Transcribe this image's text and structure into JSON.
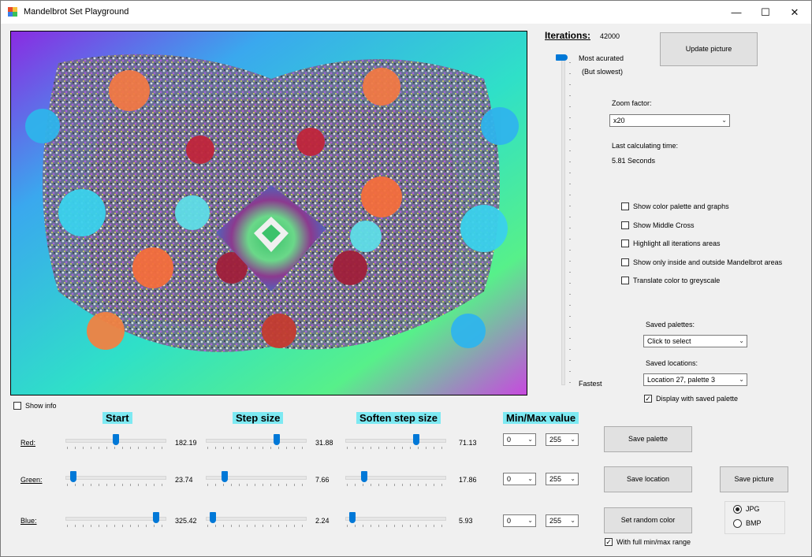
{
  "window": {
    "title": "Mandelbrot Set Playground",
    "controls": {
      "minimize": "—",
      "maximize": "☐",
      "close": "✕"
    }
  },
  "iterations": {
    "label": "Iterations:",
    "value": "42000",
    "top_label": "Most acurated",
    "top_sublabel": "(But slowest)",
    "bottom_label": "Fastest",
    "slider_level": 1.0
  },
  "update_button": "Update picture",
  "zoom": {
    "label": "Zoom factor:",
    "value": "x20"
  },
  "calc_time": {
    "label": "Last calculating time:",
    "value": "5.81 Seconds"
  },
  "checkboxes": [
    {
      "label": "Show color palette and graphs",
      "checked": false
    },
    {
      "label": "Show Middle Cross",
      "checked": false
    },
    {
      "label": "Highlight all iterations areas",
      "checked": false
    },
    {
      "label": "Show only inside and outside Mandelbrot areas",
      "checked": false
    },
    {
      "label": "Translate color to greyscale",
      "checked": false
    }
  ],
  "saved_palettes": {
    "label": "Saved palettes:",
    "value": "Click to select"
  },
  "saved_locations": {
    "label": "Saved locations:",
    "value": "Location 27, palette 3"
  },
  "display_saved_palette": {
    "label": "Display with saved palette",
    "checked": true
  },
  "show_info": {
    "label": "Show info",
    "checked": false
  },
  "headers": {
    "start": "Start",
    "step": "Step size",
    "soften": "Soften step size",
    "minmax": "Min/Max value"
  },
  "channels": [
    {
      "name": "Red:",
      "start": "182.19",
      "start_frac": 0.5,
      "step": "31.88",
      "step_frac": 0.7,
      "soften": "71.13",
      "soften_frac": 0.7,
      "min": "0",
      "max": "255"
    },
    {
      "name": "Green:",
      "start": "23.74",
      "start_frac": 0.08,
      "step": "7.66",
      "step_frac": 0.19,
      "soften": "17.86",
      "soften_frac": 0.19,
      "min": "0",
      "max": "255"
    },
    {
      "name": "Blue:",
      "start": "325.42",
      "start_frac": 0.9,
      "step": "2.24",
      "step_frac": 0.07,
      "soften": "5.93",
      "soften_frac": 0.07,
      "min": "0",
      "max": "255"
    }
  ],
  "buttons": {
    "save_palette": "Save  palette",
    "save_location": "Save location",
    "save_picture": "Save picture",
    "random_color": "Set random color"
  },
  "full_range": {
    "label": "With full min/max range",
    "checked": true
  },
  "format": {
    "jpg": "JPG",
    "bmp": "BMP",
    "selected": "JPG"
  }
}
